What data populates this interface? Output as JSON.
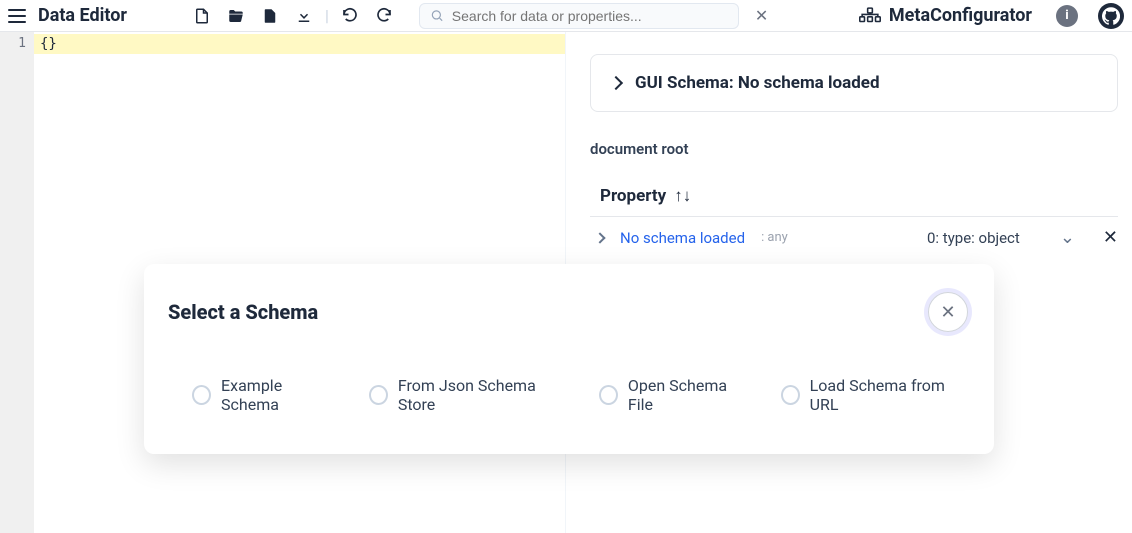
{
  "header": {
    "title": "Data Editor",
    "search_placeholder": "Search for data or properties...",
    "brand": "MetaConfigurator"
  },
  "editor": {
    "line_numbers": [
      "1"
    ],
    "content_line1": "{}"
  },
  "right": {
    "schema_box": "GUI Schema: No schema loaded",
    "doc_root": "document root",
    "property_header": "Property",
    "row": {
      "label": "No schema loaded",
      "anytag": ": any",
      "type": "0: type: object"
    }
  },
  "modal": {
    "title": "Select a Schema",
    "options": [
      "Example Schema",
      "From Json Schema Store",
      "Open Schema File",
      "Load Schema from URL"
    ]
  }
}
